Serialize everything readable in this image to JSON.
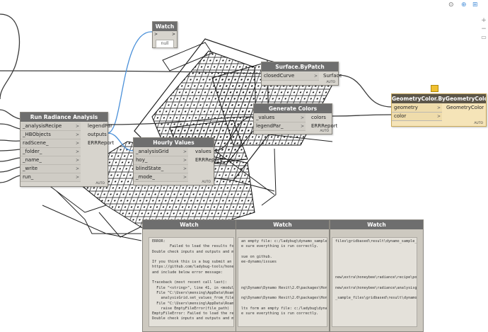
{
  "nodes": {
    "watch_small": {
      "title": "Watch",
      "value": "null",
      "auto": ""
    },
    "surface_bypatch": {
      "title": "Surface.ByPatch",
      "inputs": [
        "closedCurve"
      ],
      "outputs": [
        "Surface"
      ],
      "auto": "AUTO"
    },
    "geometry_color": {
      "title": "GeometryColor.ByGeometryColor",
      "inputs": [
        "geometry",
        "color"
      ],
      "outputs": [
        "GeometryColor"
      ],
      "auto": "AUTO"
    },
    "generate_colors": {
      "title": "Generate Colors",
      "inputs": [
        "_values",
        "legendPar_"
      ],
      "outputs": [
        "colors",
        "ERRReport"
      ],
      "auto": "AUTO"
    },
    "run_radiance": {
      "title": "Run Radiance Analysis",
      "inputs": [
        "_analysisRecipe",
        "_HBObjects",
        "radScene_",
        "_folder_",
        "_name_",
        "_write",
        "run_"
      ],
      "outputs": [
        "legendPar",
        "outputs",
        "ERRReport"
      ],
      "auto": "AUTO"
    },
    "hourly_values": {
      "title": "Hourly Values",
      "inputs": [
        "_analysisGrid",
        "hoy_",
        "blindState_",
        "_mode_"
      ],
      "outputs": [
        "values",
        "ERRReport"
      ],
      "auto": "AUTO"
    }
  },
  "watch_panels": [
    {
      "title": "Watch",
      "text": "ERROR:\n        Failed to load the results form an empty file: c:/ladybug\\dynamo_sample_f\nDouble check inputs and outputs and make sure everything is run correctly.\n\nIf you think this is a bug submit an issue on github.\nhttps://github.com/ladybug-tools/honeybee-dynamo/issues\nand include below error message:\n\nTraceback (most recent call last):\n  File \"<string>\", line 41, in <module>\n  File \"C:\\Users\\mensing\\AppData\\Roaming\\Dynamo\\Dynamo Revit\\2.0\\packages\\Honeyt\n    analysisGrid.set_values_from_file(\n  File \"C:\\Users\\mensing\\AppData\\Roaming\\Dynamo\\Dynamo Revit\\2.0\\packages\\Honeyt\n    raise EmptyFileError(file_path)\nEmptyFileError: Failed to load the results form an empty file: c:/ladybug\\dynamo\nDouble check inputs and outputs and make sure everything is run correctly."
    },
    {
      "title": "Watch",
      "text": "an empty file: c:/ladybug\\dynamo_sample_fi\ne sure everything is run correctly.\n\nsue on github.\nee-dynamo/issues\n\n\n\n\nng\\Dynamo\\Dynamo Revit\\2.0\\packages\\Honeyt\n\nng\\Dynamo\\Dynamo Revit\\2.0\\packages\\Honeyt\n\nlts form an empty file: c:/ladybug\\dynamo_sam\ne sure everything is run correctly."
    },
    {
      "title": "Watch",
      "text": "files\\gridbased\\result\\dynamo_sample_files.\n\n\n\n\n\n\nnew\\extra\\honeybee\\radiance\\recipe\\pointin\n\nnew\\extra\\honeybee\\radiance\\analysisgrid.p\n\n_sample_files\\gridbased\\result\\dynamo_samp"
    }
  ],
  "toolbar": {
    "icons": [
      "link-icon",
      "pin-icon",
      "view-icon"
    ]
  },
  "colors": {
    "node_title": "#6e6e6e",
    "node_body": "#d7d4cd",
    "selected": "#f2dfb0",
    "wire_blue": "#4a90d9",
    "wire_dark": "#3a3a3a"
  }
}
